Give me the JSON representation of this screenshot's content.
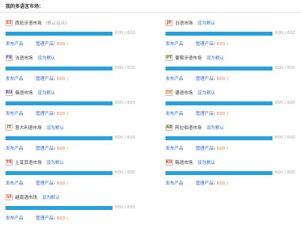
{
  "page": {
    "title": "我的多语言市场："
  },
  "labels": {
    "publish": "发布产品",
    "manage": "管理产品",
    "set_default": "设为默认"
  },
  "markets": [
    {
      "code": "ES",
      "code_color": "#e0503a",
      "name": "西班牙语市场",
      "default_text": "(默认站点)",
      "progress": 1.0,
      "progress_text": "600 / 600",
      "count_text": "( 600 )"
    },
    {
      "code": "JP",
      "code_color": "#e0503a",
      "name": "日语市场",
      "progress": 1.0,
      "progress_text": "600 / 600",
      "count_text": "( 600 )"
    },
    {
      "code": "FR",
      "code_color": "#2f5fb8",
      "name": "法语市场",
      "progress": 1.0,
      "progress_text": "600 / 600",
      "count_text": "( 600 )"
    },
    {
      "code": "PT",
      "code_color": "#2f8a3a",
      "name": "葡萄牙语市场",
      "progress": 1.0,
      "progress_text": "600 / 600",
      "count_text": "( 600 )"
    },
    {
      "code": "RU",
      "code_color": "#2f5fb8",
      "name": "俄语市场",
      "progress": 1.0,
      "progress_text": "600 / 600",
      "count_text": "( 600 )"
    },
    {
      "code": "DE",
      "code_color": "#e0903a",
      "name": "德语市场",
      "progress": 1.0,
      "progress_text": "600 / 600",
      "count_text": "( 600 )"
    },
    {
      "code": "IT",
      "code_color": "#2f8a3a",
      "name": "意大利语市场",
      "progress": 1.0,
      "progress_text": "600 / 600",
      "count_text": "( 600 )"
    },
    {
      "code": "AR",
      "code_color": "#2f8a3a",
      "name": "阿拉伯语市场",
      "progress": 1.0,
      "progress_text": "600 / 600",
      "count_text": "( 600 )"
    },
    {
      "code": "TR",
      "code_color": "#e0503a",
      "name": "土耳其语市场",
      "progress": 1.0,
      "progress_text": "600 / 600",
      "count_text": "( 600 )"
    },
    {
      "code": "KO",
      "code_color": "#e0503a",
      "name": "韩语市场",
      "progress": 1.0,
      "progress_text": "600 / 600",
      "count_text": "( 600 )"
    },
    {
      "code": "VI",
      "code_color": "#e0503a",
      "name": "越南语市场",
      "progress": 1.0,
      "progress_text": "600 / 600",
      "count_text": "( 600 )"
    }
  ]
}
